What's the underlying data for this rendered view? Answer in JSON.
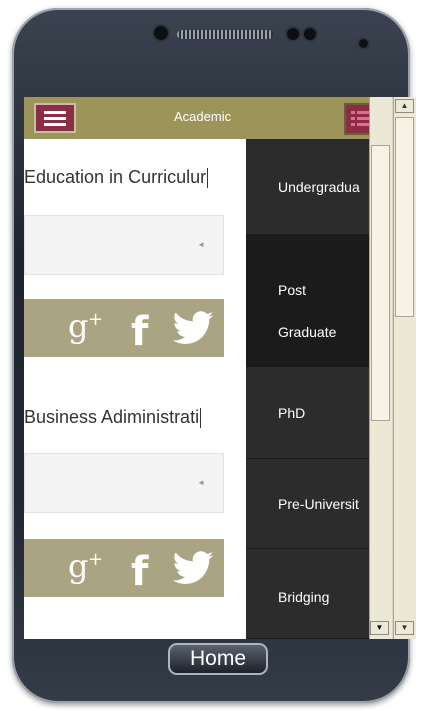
{
  "app_bar": {
    "title": "Academic",
    "menu_icon": "hamburger-icon",
    "list_icon": "list-icon",
    "color": "#9d9459",
    "button_color": "#8a2d45"
  },
  "content": {
    "cards": [
      {
        "field_value": "Education in Curriculur",
        "social": [
          "google-plus-icon",
          "facebook-icon",
          "twitter-icon"
        ]
      },
      {
        "field_value": "Business Adiministrati",
        "social": [
          "google-plus-icon",
          "facebook-icon",
          "twitter-icon"
        ]
      }
    ]
  },
  "drawer": {
    "items": [
      {
        "label": "Undergradua"
      },
      {
        "label_line1": "Post",
        "label_line2": "Graduate"
      },
      {
        "label": "PhD"
      },
      {
        "label": "Pre-Universit"
      },
      {
        "label": "Bridging"
      }
    ]
  },
  "device": {
    "home_label": "Home"
  }
}
